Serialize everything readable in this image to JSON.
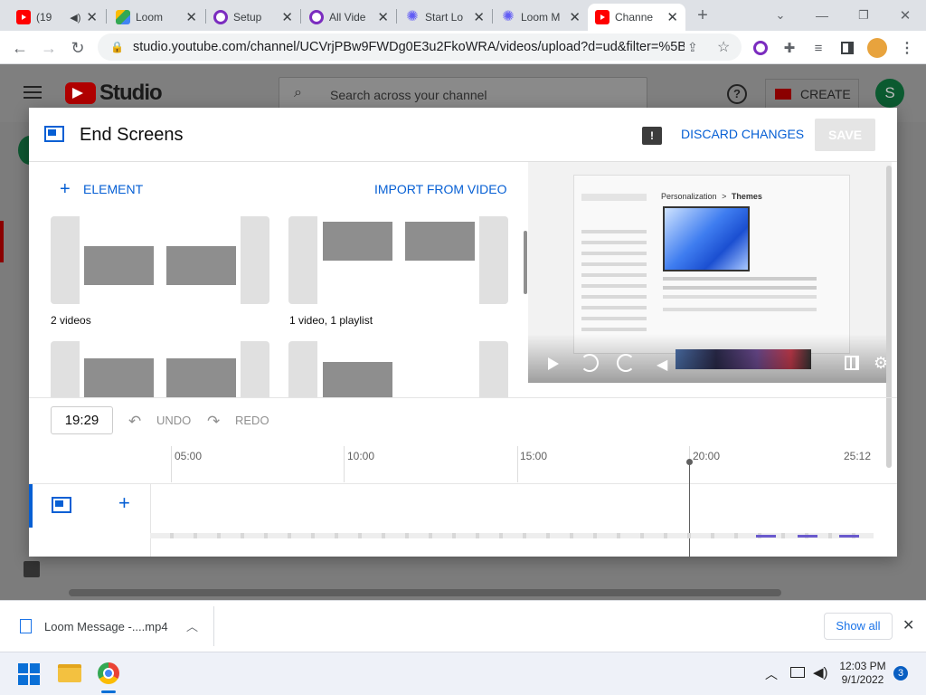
{
  "browser": {
    "tabs": [
      {
        "title": "(19",
        "favicon": "youtube-icon",
        "color": "#ff0000",
        "has_audio": true
      },
      {
        "title": "Loom",
        "favicon": "google-drive-icon",
        "color": "#fbbc04"
      },
      {
        "title": "Setup",
        "favicon": "chrome-icon",
        "color": "#7b2cbf"
      },
      {
        "title": "All Vide",
        "favicon": "chrome-icon",
        "color": "#7b2cbf"
      },
      {
        "title": "Start Lo",
        "favicon": "loom-icon",
        "color": "#625df5"
      },
      {
        "title": "Loom M",
        "favicon": "loom-icon",
        "color": "#625df5"
      },
      {
        "title": "Channe",
        "favicon": "youtube-icon",
        "color": "#ff0000",
        "active": true
      }
    ],
    "new_tab": "+",
    "url": "studio.youtube.com/channel/UCVrjPBw9FWDg0E3u2FkoWRA/videos/upload?d=ud&filter=%5B..."
  },
  "studio": {
    "logo": "Studio",
    "search_placeholder": "Search across your channel",
    "create_label": "CREATE",
    "avatar_letter": "S"
  },
  "dialog": {
    "title": "End Screens",
    "discard_label": "DISCARD CHANGES",
    "save_label": "SAVE",
    "add_element_label": "ELEMENT",
    "import_label": "IMPORT FROM VIDEO",
    "templates": [
      {
        "label": "2 videos"
      },
      {
        "label": "1 video, 1 playlist"
      },
      {
        "label": ""
      },
      {
        "label": ""
      }
    ],
    "timecode": "19:29",
    "undo_label": "UNDO",
    "redo_label": "REDO",
    "timeline_ticks": [
      "05:00",
      "10:00",
      "15:00",
      "20:00",
      "25:12"
    ],
    "preview": {
      "settings_title": "Personalization",
      "breadcrumb_sep": ">",
      "breadcrumb_page": "Themes"
    }
  },
  "downloads": {
    "file": "Loom Message -....mp4",
    "show_all": "Show all"
  },
  "taskbar": {
    "time": "12:03 PM",
    "date": "9/1/2022",
    "notifications": "3"
  },
  "colors": {
    "accent_blue": "#065fd4",
    "youtube_red": "#ff0000"
  }
}
